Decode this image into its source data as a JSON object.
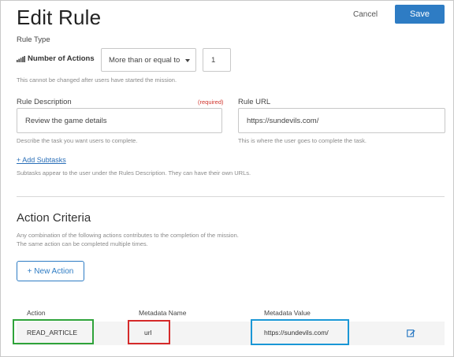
{
  "header": {
    "title": "Edit Rule",
    "cancel_label": "Cancel",
    "save_label": "Save"
  },
  "rule_type": {
    "label": "Rule Type",
    "field_label": "Number of Actions",
    "icon": "signal-bars-icon",
    "comparator": "More than or equal to",
    "count": "1",
    "help": "This cannot be changed after users have started the mission."
  },
  "description": {
    "label": "Rule Description",
    "required": "(required)",
    "value": "Review the game details",
    "help": "Describe the task you want users to complete."
  },
  "rule_url": {
    "label": "Rule URL",
    "value": "https://sundevils.com/",
    "help": "This is where the user goes to complete the task."
  },
  "subtasks": {
    "link": "+ Add Subtasks",
    "help": "Subtasks appear to the user under the Rules Description. They can have their own URLs."
  },
  "criteria": {
    "title": "Action Criteria",
    "help_line1": "Any combination of the following actions contributes to the completion of the mission.",
    "help_line2": "The same action can be completed multiple times.",
    "new_action_label": "+ New Action",
    "columns": {
      "action": "Action",
      "metadata_name": "Metadata Name",
      "metadata_value": "Metadata Value"
    },
    "rows": [
      {
        "action": "READ_ARTICLE",
        "metadata_name": "url",
        "metadata_value": "https://sundevils.com/",
        "icon": "edit-icon"
      }
    ]
  },
  "colors": {
    "accent": "#2e7cc4",
    "required": "#d0342c",
    "highlight_green": "#2fa33a",
    "highlight_red": "#d52a2a",
    "highlight_blue": "#1a97d6"
  }
}
